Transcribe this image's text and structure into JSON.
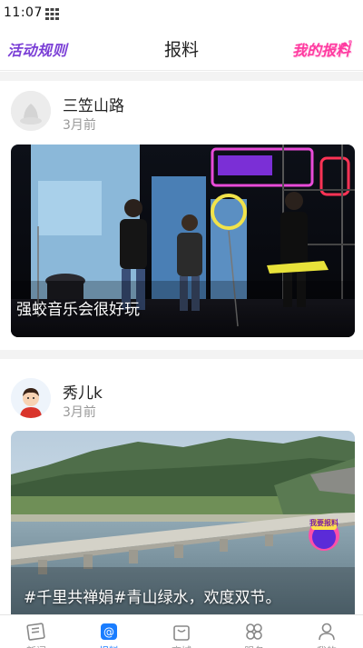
{
  "status_bar": {
    "time": "11:07",
    "grid_icon": "app-grid-icon"
  },
  "nav": {
    "left_label": "活动规则",
    "title": "报料",
    "right_label": "我的报料",
    "left_color": "#7b3fd6",
    "right_color": "#ff3aa0"
  },
  "posts": [
    {
      "author": "三笠山路",
      "time": "3月前",
      "avatar_icon": "default-avatar-icon",
      "caption": "强蛟音乐会很好玩"
    },
    {
      "author": "秀儿k",
      "time": "3月前",
      "avatar_icon": "cartoon-avatar-icon",
      "caption": "#千里共禅娟#青山绿水，欢度双节。",
      "badge_text": "我要报料"
    }
  ],
  "tabs": [
    {
      "label": "新闻",
      "icon": "newspaper-icon",
      "active": false
    },
    {
      "label": "报料",
      "icon": "report-at-icon",
      "active": true
    },
    {
      "label": "商城",
      "icon": "shopping-bag-icon",
      "active": false
    },
    {
      "label": "服务",
      "icon": "service-grid-icon",
      "active": false
    },
    {
      "label": "我的",
      "icon": "user-icon",
      "active": false
    }
  ],
  "colors": {
    "accent": "#1a7dff",
    "muted": "#999999"
  }
}
